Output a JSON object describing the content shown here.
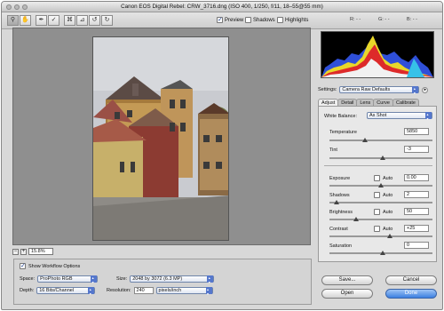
{
  "window": {
    "title": "Canon EOS Digital Rebel:  CRW_3716.dng  (ISO 400, 1/250, f/11, 18–55@55 mm)"
  },
  "toolbar": {
    "preview_label": "Preview",
    "preview_checked": true,
    "shadows_label": "Shadows",
    "shadows_checked": false,
    "highlights_label": "Highlights",
    "highlights_checked": false,
    "r_label": "R:",
    "r_value": "- -",
    "g_label": "G:",
    "g_value": "- -",
    "b_label": "B:",
    "b_value": "- -"
  },
  "zoom": {
    "minus": "−",
    "plus": "+",
    "value": "15.8%"
  },
  "workflow": {
    "show_label": "Show Workflow Options",
    "space_label": "Space:",
    "space_value": "ProPhoto RGB",
    "size_label": "Size:",
    "size_value": "2048 by 3072  (6.3 MP)",
    "depth_label": "Depth:",
    "depth_value": "16 Bits/Channel",
    "resolution_label": "Resolution:",
    "resolution_value": "240",
    "resolution_unit": "pixels/inch"
  },
  "settings": {
    "label": "Settings:",
    "value": "Camera Raw Defaults"
  },
  "tabs": [
    "Adjust",
    "Detail",
    "Lens",
    "Curve",
    "Calibrate"
  ],
  "adjust": {
    "white_balance_label": "White Balance:",
    "white_balance_value": "As Shot",
    "temperature_label": "Temperature",
    "temperature_value": "5850",
    "tint_label": "Tint",
    "tint_value": "-3",
    "exposure_label": "Exposure",
    "exposure_value": "0.00",
    "shadows_label": "Shadows",
    "shadows_value": "2",
    "brightness_label": "Brightness",
    "brightness_value": "50",
    "contrast_label": "Contrast",
    "contrast_value": "+25",
    "saturation_label": "Saturation",
    "saturation_value": "0",
    "auto_label": "Auto"
  },
  "buttons": {
    "save": "Save...",
    "cancel": "Cancel",
    "open": "Open",
    "done": "Done"
  },
  "colors": {
    "accent": "#3b7fe0",
    "window": "#d8d8d8"
  }
}
